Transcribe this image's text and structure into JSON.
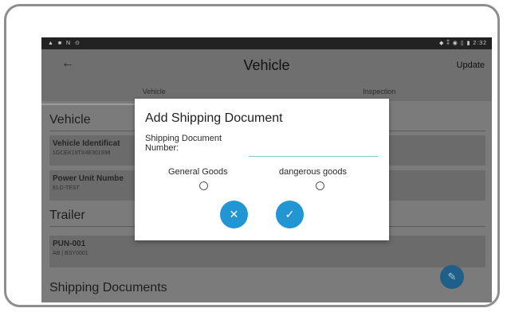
{
  "status_bar": {
    "left_icons": "▲ ■ N ⊙",
    "right_icons": "◆ ⁑ ◉ ▯ ▮ 2:32"
  },
  "app_bar": {
    "back_icon": "back-arrow-icon",
    "back_glyph": "←",
    "title": "Vehicle",
    "action_label": "Update"
  },
  "tabs": [
    {
      "label": "Vehicle"
    },
    {
      "label": "Inspection"
    }
  ],
  "sections": {
    "vehicle": "Vehicle",
    "trailer": "Trailer",
    "shipping": "Shipping Documents"
  },
  "cards": {
    "vin": {
      "title": "Vehicle Identificat",
      "value": "1GCEK19TX4E301998"
    },
    "power_unit": {
      "title": "Power Unit Numbe",
      "value": "ELD-TEST"
    },
    "trailer": {
      "title": "PUN-001",
      "value": "AB | BSY0001"
    }
  },
  "fab": {
    "icon": "edit-pencil-icon",
    "glyph": "✎"
  },
  "dialog": {
    "title": "Add Shipping Document",
    "field_label": "Shipping Document Number:",
    "field_value": "",
    "radio_general": "General Goods",
    "radio_dangerous": "dangerous goods",
    "cancel_glyph": "✕",
    "confirm_glyph": "✓"
  },
  "colors": {
    "accent": "#2196d3",
    "overlay": "#7b7b7b",
    "input_underline": "#8fc6cb",
    "fab_dimmed": "#1f5f88"
  }
}
